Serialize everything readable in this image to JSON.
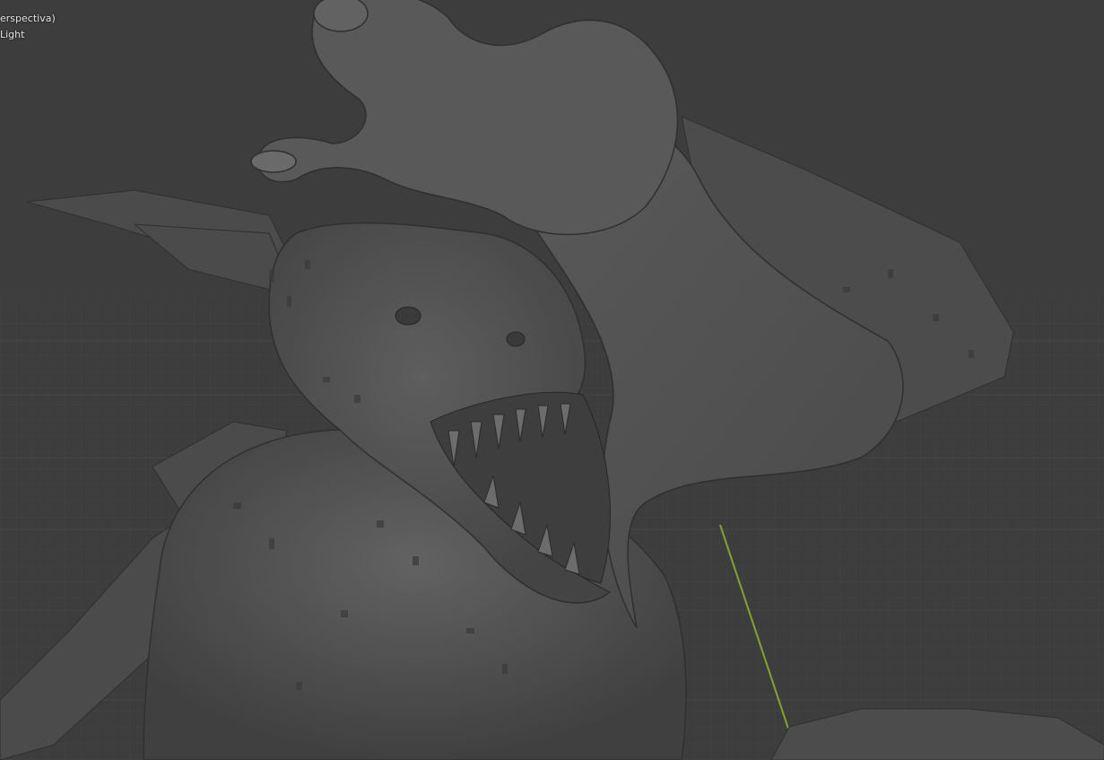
{
  "viewport": {
    "view_label": "erspectiva)",
    "object_label": "Light",
    "background_color": "#3d3d3d",
    "grid_color": "#484848",
    "y_axis_color": "#7fa52b",
    "model_shade": "#555555",
    "mode": "solid"
  }
}
